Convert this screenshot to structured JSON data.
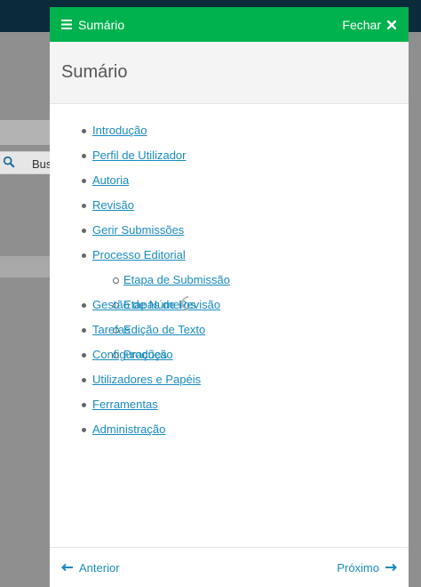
{
  "background": {
    "search_partial_text": "Bus"
  },
  "panel": {
    "header": {
      "menu_label": "Sumário",
      "close_label": "Fechar"
    },
    "title": "Sumário",
    "toc": [
      {
        "label": "Introdução"
      },
      {
        "label": "Perfil de Utilizador"
      },
      {
        "label": "Autoria"
      },
      {
        "label": "Revisão"
      },
      {
        "label": "Gerir Submissões"
      },
      {
        "label": "Processo Editorial",
        "children": [
          {
            "label": "Etapa de Submissão"
          },
          {
            "label": "Etapas de Revisão"
          },
          {
            "label": "Edição de Texto"
          },
          {
            "label": "Produção"
          }
        ]
      },
      {
        "label": "Gestão de Números"
      },
      {
        "label": "Tarefas"
      },
      {
        "label": "Configurações"
      },
      {
        "label": "Utilizadores e Papéis"
      },
      {
        "label": "Ferramentas"
      },
      {
        "label": "Administração"
      }
    ],
    "footer": {
      "previous_label": "Anterior",
      "next_label": "Próximo"
    }
  },
  "colors": {
    "header_green": "#00b24e",
    "link_blue": "#1a8bbf",
    "top_bar_navy": "#0b2a3a"
  }
}
